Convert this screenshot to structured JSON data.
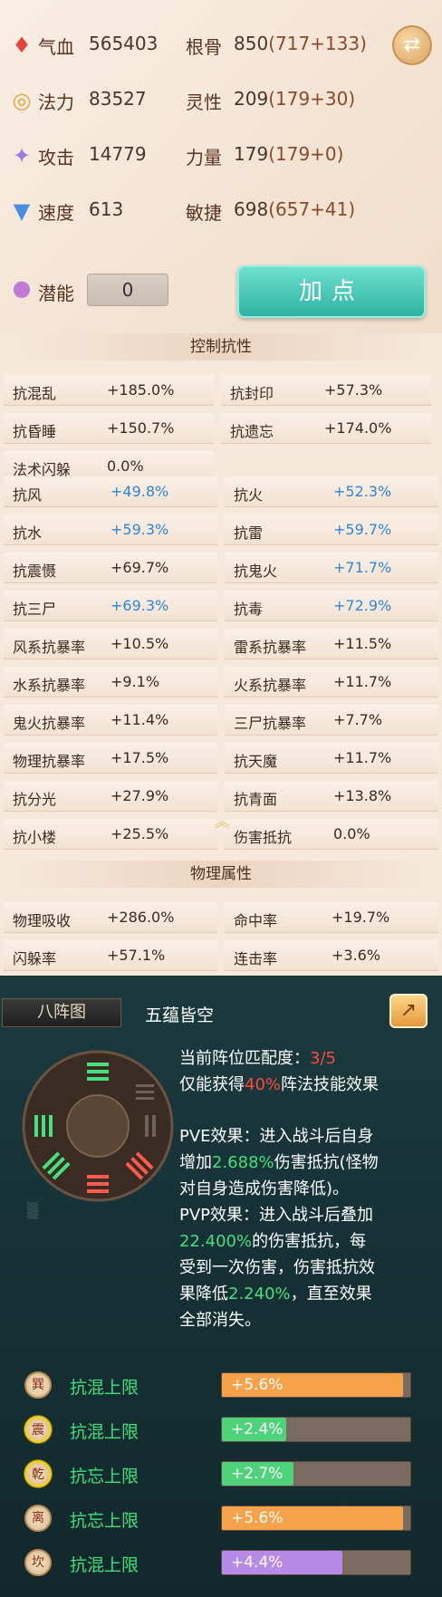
{
  "stats": {
    "rows": [
      {
        "icon": "blood-icon",
        "glyph": "🩸",
        "name": "气血",
        "value": "565403",
        "name2": "根骨",
        "base2": "850",
        "bonus2": "(717+133)"
      },
      {
        "icon": "mana-icon",
        "glyph": "💧",
        "name": "法力",
        "value": "83527",
        "name2": "灵性",
        "base2": "209",
        "bonus2": "(179+30)"
      },
      {
        "icon": "attack-icon",
        "glyph": "⚔",
        "name": "攻击",
        "value": "14779",
        "name2": "力量",
        "base2": "179",
        "bonus2": "(179+0)"
      },
      {
        "icon": "speed-icon",
        "glyph": "👢",
        "name": "速度",
        "value": "613",
        "name2": "敏捷",
        "base2": "698",
        "bonus2": "(657+41)"
      }
    ],
    "potential_label": "潜能",
    "potential_value": "0",
    "add_points_label": "加点"
  },
  "control_resist": {
    "title": "控制抗性",
    "items": [
      {
        "k": "抗混乱",
        "v": "+185.0%"
      },
      {
        "k": "抗封印",
        "v": "+57.3%"
      },
      {
        "k": "抗昏睡",
        "v": "+150.7%"
      },
      {
        "k": "抗遗忘",
        "v": "+174.0%"
      },
      {
        "k": "法术闪躲",
        "v": "0.0%"
      }
    ]
  },
  "elemental_resist": {
    "items": [
      {
        "k": "抗风",
        "v": "+49.8%",
        "blue": true
      },
      {
        "k": "抗火",
        "v": "+52.3%",
        "blue": true
      },
      {
        "k": "抗水",
        "v": "+59.3%",
        "blue": true
      },
      {
        "k": "抗雷",
        "v": "+59.7%",
        "blue": true
      },
      {
        "k": "抗震慑",
        "v": "+69.7%",
        "blue": false
      },
      {
        "k": "抗鬼火",
        "v": "+71.7%",
        "blue": true
      },
      {
        "k": "抗三尸",
        "v": "+69.3%",
        "blue": true
      },
      {
        "k": "抗毒",
        "v": "+72.9%",
        "blue": true
      },
      {
        "k": "风系抗暴率",
        "v": "+10.5%",
        "blue": false
      },
      {
        "k": "雷系抗暴率",
        "v": "+11.5%",
        "blue": false
      },
      {
        "k": "水系抗暴率",
        "v": "+9.1%",
        "blue": false
      },
      {
        "k": "火系抗暴率",
        "v": "+11.7%",
        "blue": false
      },
      {
        "k": "鬼火抗暴率",
        "v": "+11.4%",
        "blue": false
      },
      {
        "k": "三尸抗暴率",
        "v": "+7.7%",
        "blue": false
      },
      {
        "k": "物理抗暴率",
        "v": "+17.5%",
        "blue": false
      },
      {
        "k": "抗天魔",
        "v": "+11.7%",
        "blue": false
      },
      {
        "k": "抗分光",
        "v": "+27.9%",
        "blue": false
      },
      {
        "k": "抗青面",
        "v": "+13.8%",
        "blue": false
      },
      {
        "k": "抗小楼",
        "v": "+25.5%",
        "blue": false
      },
      {
        "k": "伤害抵抗",
        "v": "0.0%",
        "blue": false
      }
    ]
  },
  "physical": {
    "title": "物理属性",
    "items": [
      {
        "k": "物理吸收",
        "v": "+286.0%"
      },
      {
        "k": "命中率",
        "v": "+19.7%"
      },
      {
        "k": "闪躲率",
        "v": "+57.1%"
      },
      {
        "k": "连击率",
        "v": "+3.6%"
      }
    ]
  },
  "formation": {
    "tab_label": "八阵图",
    "name": "五蕴皆空",
    "match_label": "当前阵位匹配度：",
    "match_value": "3/5",
    "gain_prefix": "仅能获得",
    "gain_pct": "40%",
    "gain_suffix": "阵法技能效果",
    "pve_1": "PVE效果：进入战斗后自身",
    "pve_2a": "增加",
    "pve_2b": "2.688%",
    "pve_2c": "伤害抵抗(怪物",
    "pve_3": "对自身造成伤害降低)。",
    "pvp_1": "PVP效果：进入战斗后叠加",
    "pvp_2a": "22.400%",
    "pvp_2b": "的伤害抵抗，每",
    "pvp_3": "受到一次伤害，伤害抵抗效",
    "pvp_4a": "果降低",
    "pvp_4b": "2.240%",
    "pvp_4c": "，直至效果",
    "pvp_5": "全部消失。",
    "bonuses": [
      {
        "badge": "巽",
        "ring": false,
        "label": "抗混上限",
        "value": "+5.6%",
        "fill": 0.96,
        "color": "orange"
      },
      {
        "badge": "震",
        "ring": true,
        "label": "抗混上限",
        "value": "+2.4%",
        "fill": 0.34,
        "color": "green"
      },
      {
        "badge": "乾",
        "ring": true,
        "label": "抗忘上限",
        "value": "+2.7%",
        "fill": 0.38,
        "color": "green"
      },
      {
        "badge": "离",
        "ring": false,
        "label": "抗忘上限",
        "value": "+5.6%",
        "fill": 0.96,
        "color": "orange"
      },
      {
        "badge": "坎",
        "ring": false,
        "label": "抗混上限",
        "value": "+4.4%",
        "fill": 0.64,
        "color": "purple"
      }
    ],
    "colors": {
      "orange": "#f5a24a",
      "green": "#4fd37a",
      "purple": "#b88ae8"
    }
  }
}
